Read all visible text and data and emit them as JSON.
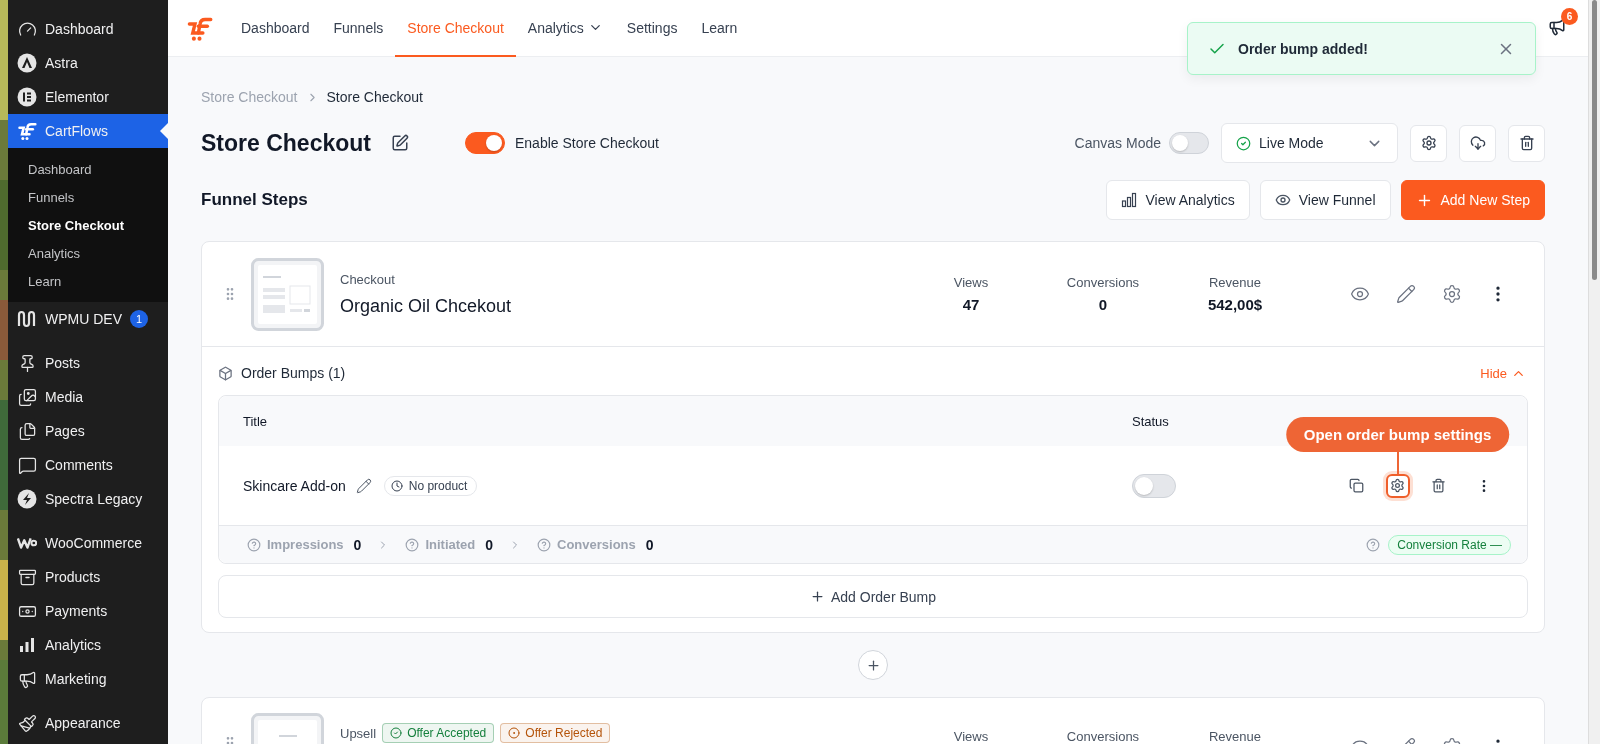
{
  "sidebar": {
    "groups": [
      {
        "items": [
          {
            "label": "Dashboard",
            "selected": false
          },
          {
            "label": "Astra",
            "selected": false
          },
          {
            "label": "Elementor",
            "selected": false
          },
          {
            "label": "CartFlows",
            "selected": true,
            "children": [
              {
                "label": "Dashboard",
                "selected": false
              },
              {
                "label": "Funnels",
                "selected": false
              },
              {
                "label": "Store Checkout",
                "selected": true
              },
              {
                "label": "Analytics",
                "selected": false
              },
              {
                "label": "Learn",
                "selected": false
              }
            ]
          },
          {
            "label": "WPMU DEV",
            "selected": false,
            "badge": "1"
          }
        ]
      },
      {
        "items": [
          {
            "label": "Posts",
            "selected": false
          },
          {
            "label": "Media",
            "selected": false
          },
          {
            "label": "Pages",
            "selected": false
          },
          {
            "label": "Comments",
            "selected": false
          },
          {
            "label": "Spectra Legacy",
            "selected": false
          }
        ]
      },
      {
        "items": [
          {
            "label": "WooCommerce",
            "selected": false
          },
          {
            "label": "Products",
            "selected": false
          },
          {
            "label": "Payments",
            "selected": false
          },
          {
            "label": "Analytics",
            "selected": false
          },
          {
            "label": "Marketing",
            "selected": false
          }
        ]
      },
      {
        "items": [
          {
            "label": "Appearance",
            "selected": false
          }
        ]
      }
    ]
  },
  "top_nav": {
    "tabs": [
      {
        "label": "Dashboard",
        "selected": false,
        "dropdown": false
      },
      {
        "label": "Funnels",
        "selected": false,
        "dropdown": false
      },
      {
        "label": "Store Checkout",
        "selected": true,
        "dropdown": false
      },
      {
        "label": "Analytics",
        "selected": false,
        "dropdown": true
      },
      {
        "label": "Settings",
        "selected": false,
        "dropdown": false
      },
      {
        "label": "Learn",
        "selected": false,
        "dropdown": false
      }
    ],
    "notification_count": "6"
  },
  "toast": {
    "message": "Order bump added!"
  },
  "breadcrumb": [
    "Store Checkout",
    "Store Checkout"
  ],
  "header": {
    "title": "Store Checkout",
    "enable_toggle": {
      "label": "Enable Store Checkout",
      "on": true
    },
    "canvas_mode": {
      "label": "Canvas Mode",
      "on": false
    },
    "mode_select": {
      "value": "Live Mode"
    }
  },
  "section": {
    "title": "Funnel Steps",
    "buttons": [
      {
        "label": "View Analytics",
        "kind": "secondary"
      },
      {
        "label": "View Funnel",
        "kind": "secondary"
      },
      {
        "label": "Add New Step",
        "kind": "primary"
      }
    ]
  },
  "steps": [
    {
      "type": "Checkout",
      "name": "Organic Oil Chcekout",
      "stats": [
        {
          "label": "Views",
          "value": "47"
        },
        {
          "label": "Conversions",
          "value": "0"
        },
        {
          "label": "Revenue",
          "value": "542,00$"
        }
      ],
      "order_bumps": {
        "title": "Order Bumps (1)",
        "toggle_label": "Hide",
        "expanded": true,
        "columns": [
          "Title",
          "Status"
        ],
        "rows": [
          {
            "title": "Skincare Add-on",
            "product": "No product",
            "on": false,
            "metrics": [
              {
                "label": "Impressions",
                "value": "0"
              },
              {
                "label": "Initiated",
                "value": "0"
              },
              {
                "label": "Conversions",
                "value": "0"
              }
            ],
            "rate": "Conversion Rate —"
          }
        ],
        "add_label": "Add Order Bump"
      }
    },
    {
      "type": "Upsell",
      "badges": [
        {
          "label": "Offer Accepted",
          "kind": "accepted",
          "color": "#15803d"
        },
        {
          "label": "Offer Rejected",
          "kind": "rejected",
          "color": "#b45309"
        }
      ],
      "stats": [
        {
          "label": "Views"
        },
        {
          "label": "Conversions"
        },
        {
          "label": "Revenue"
        }
      ]
    }
  ],
  "callout": {
    "text": "Open order bump settings"
  }
}
